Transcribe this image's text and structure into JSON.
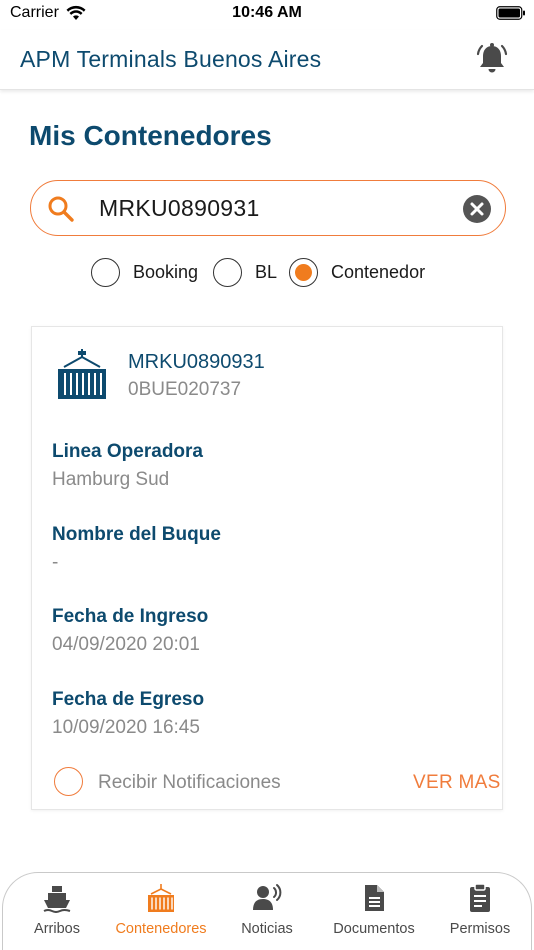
{
  "status_bar": {
    "carrier": "Carrier",
    "time": "10:46 AM"
  },
  "header": {
    "title": "APM Terminals Buenos Aires",
    "bell_icon": "bell-ringing-icon"
  },
  "page": {
    "title": "Mis Contenedores"
  },
  "search": {
    "value": "MRKU0890931",
    "search_icon": "search-icon",
    "clear_icon": "clear-icon"
  },
  "filter": {
    "options": [
      "Booking",
      "BL",
      "Contenedor"
    ],
    "selected": "Contenedor"
  },
  "card": {
    "container_number": "MRKU0890931",
    "booking_number": "0BUE020737",
    "fields": [
      {
        "label": "Linea Operadora",
        "value": "Hamburg Sud"
      },
      {
        "label": "Nombre del Buque",
        "value": "-"
      },
      {
        "label": "Fecha de Ingreso",
        "value": "04/09/2020 20:01"
      },
      {
        "label": "Fecha de Egreso",
        "value": "10/09/2020 16:45"
      }
    ],
    "notifications_label": "Recibir Notificaciones",
    "ver_mas_label": "VER MAS"
  },
  "tabs": [
    {
      "label": "Arribos",
      "icon": "ship-icon",
      "active": false
    },
    {
      "label": "Contenedores",
      "icon": "container-icon",
      "active": true
    },
    {
      "label": "Noticias",
      "icon": "speaker-icon",
      "active": false
    },
    {
      "label": "Documentos",
      "icon": "document-icon",
      "active": false
    },
    {
      "label": "Permisos",
      "icon": "clipboard-icon",
      "active": false
    }
  ],
  "colors": {
    "brand_blue": "#0d4a6e",
    "accent_orange": "#f07c1e",
    "muted_gray": "#8a8a8a"
  }
}
